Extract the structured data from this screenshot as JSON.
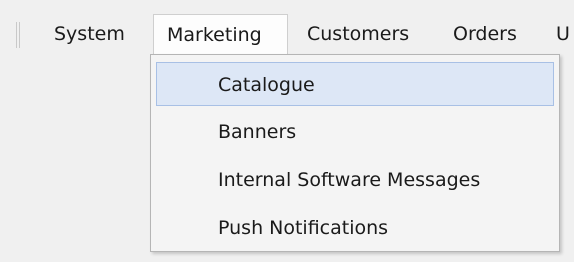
{
  "menubar": {
    "items": [
      {
        "label": "System"
      },
      {
        "label": "Marketing"
      },
      {
        "label": "Customers"
      },
      {
        "label": "Orders"
      },
      {
        "label": "U"
      }
    ],
    "open_menu": "Marketing"
  },
  "dropdown": {
    "items": [
      {
        "label": "Catalogue",
        "highlighted": true
      },
      {
        "label": "Banners"
      },
      {
        "label": "Internal Software Messages"
      },
      {
        "label": "Push Notifications"
      }
    ]
  },
  "colors": {
    "highlight_bg": "#dde7f6",
    "highlight_border": "#a8c0e5"
  }
}
